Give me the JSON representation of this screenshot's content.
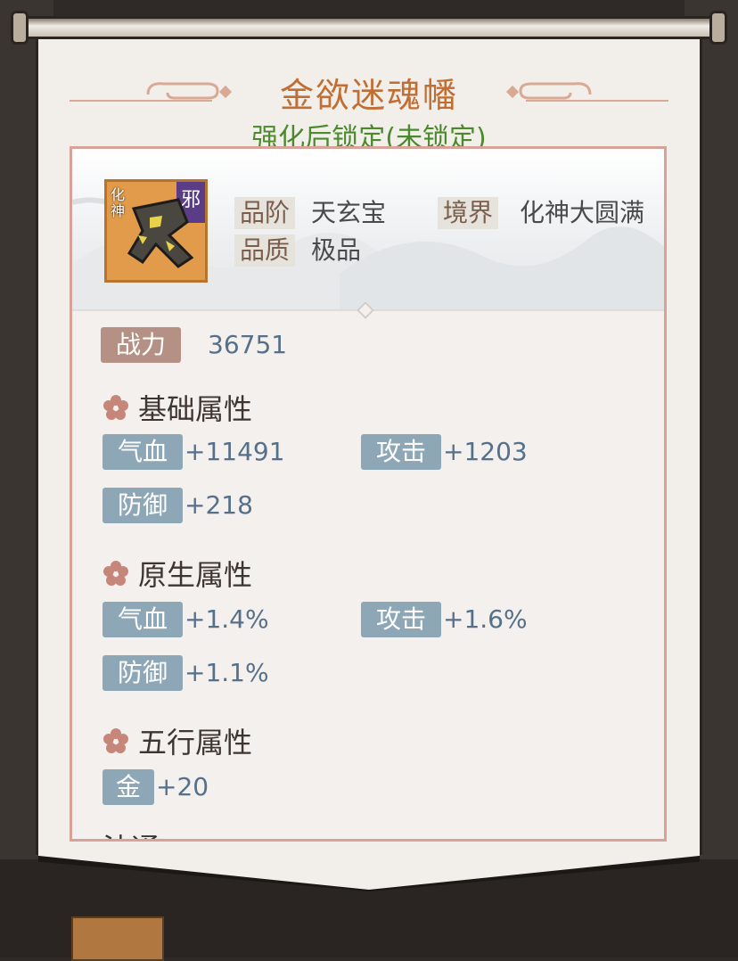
{
  "dialog": {
    "title": "金欲迷魂幡",
    "lock_status": "强化后锁定(未锁定)"
  },
  "item": {
    "icon": "banner-weapon-icon",
    "icon_rank_tag": "化神",
    "icon_class_tag": "邪",
    "grade_label": "品阶",
    "grade_value": "天玄宝",
    "realm_label": "境界",
    "realm_value": "化神大圆满",
    "quality_label": "品质",
    "quality_value": "极品"
  },
  "power": {
    "label": "战力",
    "value": "36751"
  },
  "sections": {
    "basic": {
      "title": "基础属性",
      "hp_label": "气血",
      "hp_value": "+11491",
      "atk_label": "攻击",
      "atk_value": "+1203",
      "def_label": "防御",
      "def_value": "+218"
    },
    "innate": {
      "title": "原生属性",
      "hp_label": "气血",
      "hp_value": "+1.4%",
      "atk_label": "攻击",
      "atk_value": "+1.6%",
      "def_label": "防御",
      "def_value": "+1.1%"
    },
    "elements": {
      "title": "五行属性",
      "metal_label": "金",
      "metal_value": "+20"
    },
    "next_partial": "法通"
  },
  "colors": {
    "title": "#c06e33",
    "lock_status": "#4a8a2c",
    "stat_tag": "#8ea7b7",
    "power_tag": "#b59085",
    "value_text": "#57708a",
    "panel_border": "#d7a399"
  }
}
